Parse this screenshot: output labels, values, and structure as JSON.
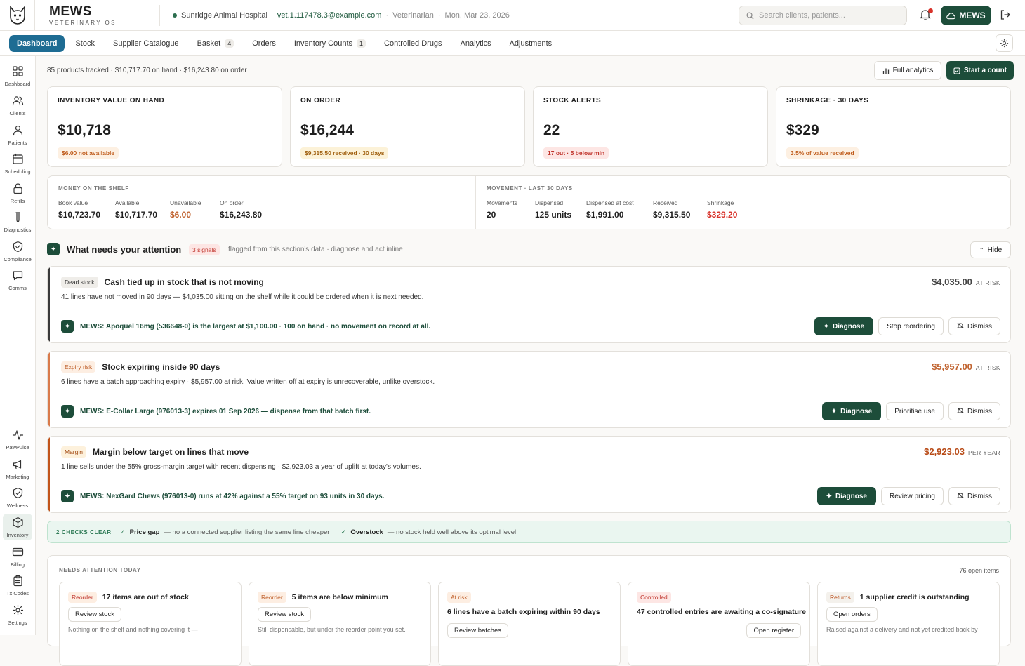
{
  "app": {
    "brand": "MEWS",
    "brand_sub": "VETERINARY OS",
    "hospital": "Sunridge Animal Hospital",
    "email": "vet.1.117478.3@example.com",
    "role": "Veterinarian",
    "date": "Mon, Mar 23, 2026",
    "search_placeholder": "Search clients, patients...",
    "mews_button": "MEWS"
  },
  "tabs": [
    {
      "label": "Dashboard",
      "count": ""
    },
    {
      "label": "Stock",
      "count": ""
    },
    {
      "label": "Supplier Catalogue",
      "count": ""
    },
    {
      "label": "Basket",
      "count": "4"
    },
    {
      "label": "Orders",
      "count": ""
    },
    {
      "label": "Inventory Counts",
      "count": "1"
    },
    {
      "label": "Controlled Drugs",
      "count": ""
    },
    {
      "label": "Analytics",
      "count": ""
    },
    {
      "label": "Adjustments",
      "count": ""
    }
  ],
  "sidebar": [
    {
      "label": "Dashboard",
      "icon": "grid-icon"
    },
    {
      "label": "Clients",
      "icon": "users-icon"
    },
    {
      "label": "Patients",
      "icon": "user-icon"
    },
    {
      "label": "Scheduling",
      "icon": "calendar-icon"
    },
    {
      "label": "Refills",
      "icon": "lock-icon"
    },
    {
      "label": "Diagnostics",
      "icon": "flask-icon"
    },
    {
      "label": "Compliance",
      "icon": "shield-check-icon"
    },
    {
      "label": "Comms",
      "icon": "chat-icon"
    },
    {
      "label": "PawPulse",
      "icon": "pulse-icon"
    },
    {
      "label": "Marketing",
      "icon": "megaphone-icon"
    },
    {
      "label": "Wellness",
      "icon": "shield-icon"
    },
    {
      "label": "Inventory",
      "icon": "box-icon"
    },
    {
      "label": "Billing",
      "icon": "card-icon"
    },
    {
      "label": "Tx Codes",
      "icon": "clipboard-icon"
    },
    {
      "label": "Settings",
      "icon": "gear-icon"
    }
  ],
  "summary": "85 products tracked · $10,717.70 on hand · $16,243.80 on order",
  "actions": {
    "full_analytics": "Full analytics",
    "start_count": "Start a count"
  },
  "kpis": [
    {
      "label": "INVENTORY VALUE ON HAND",
      "value": "$10,718",
      "pill": "$6.00 not available",
      "tone": "orange"
    },
    {
      "label": "ON ORDER",
      "value": "$16,244",
      "pill": "$9,315.50 received · 30 days",
      "tone": "yellow"
    },
    {
      "label": "STOCK ALERTS",
      "value": "22",
      "pill": "17 out · 5 below min",
      "tone": "red"
    },
    {
      "label": "SHRINKAGE · 30 DAYS",
      "value": "$329",
      "pill": "3.5% of value received",
      "tone": "orange"
    }
  ],
  "money": {
    "title": "MONEY ON THE SHELF",
    "cells": [
      {
        "label": "Book value",
        "value": "$10,723.70"
      },
      {
        "label": "Available",
        "value": "$10,717.70"
      },
      {
        "label": "Unavailable",
        "value": "$6.00"
      },
      {
        "label": "On order",
        "value": "$16,243.80"
      }
    ]
  },
  "movement": {
    "title": "MOVEMENT · LAST 30 DAYS",
    "cells": [
      {
        "label": "Movements",
        "value": "20"
      },
      {
        "label": "Dispensed",
        "value": "125 units"
      },
      {
        "label": "Dispensed at cost",
        "value": "$1,991.00"
      },
      {
        "label": "Received",
        "value": "$9,315.50"
      },
      {
        "label": "Shrinkage",
        "value": "$329.20"
      }
    ]
  },
  "attention": {
    "title": "What needs your attention",
    "signals_badge": "3 signals",
    "subtitle": "flagged from this section's data · diagnose and act inline",
    "hide": "Hide"
  },
  "signals": [
    {
      "tag": "Dead stock",
      "title": "Cash tied up in stock that is not moving",
      "desc": "41 lines have not moved in 90 days — $4,035.00 sitting on the shelf while it could be ordered when it is next needed.",
      "amount": "$4,035.00",
      "unit": "AT RISK",
      "ai": "MEWS: Apoquel 16mg (536648-0) is the largest at $1,100.00 · 100 on hand · no movement on record at all.",
      "diagnose": "Diagnose",
      "secondary": "Stop reordering",
      "dismiss": "Dismiss",
      "color": "#3a3a3a",
      "amount_color": "#444444"
    },
    {
      "tag": "Expiry risk",
      "title": "Stock expiring inside 90 days",
      "desc": "6 lines have a batch approaching expiry · $5,957.00 at risk. Value written off at expiry is unrecoverable, unlike overstock.",
      "amount": "$5,957.00",
      "unit": "AT RISK",
      "ai": "MEWS: E-Collar Large (976013-3) expires 01 Sep 2026 — dispense from that batch first.",
      "diagnose": "Diagnose",
      "secondary": "Prioritise use",
      "dismiss": "Dismiss",
      "color": "#d97a4a",
      "amount_color": "#c0622e"
    },
    {
      "tag": "Margin",
      "title": "Margin below target on lines that move",
      "desc": "1 line sells under the 55% gross-margin target with recent dispensing · $2,923.03 a year of uplift at today's volumes.",
      "amount": "$2,923.03",
      "unit": "PER YEAR",
      "ai": "MEWS: NexGard Chews (976013-0) runs at 42% against a 55% target on 93 units in 30 days.",
      "diagnose": "Diagnose",
      "secondary": "Review pricing",
      "dismiss": "Dismiss",
      "color": "#c2541a",
      "amount_color": "#b84a16"
    }
  ],
  "checks": {
    "label": "2 CHECKS CLEAR",
    "items": [
      {
        "name": "Price gap",
        "desc": "— no a connected supplier listing the same line cheaper"
      },
      {
        "name": "Overstock",
        "desc": "— no stock held well above its optimal level"
      }
    ]
  },
  "needs_today": {
    "title": "NEEDS ATTENTION TODAY",
    "count": "76 open items",
    "cards": [
      {
        "tag": "Reorder",
        "title": "17 items are out of stock",
        "button": "Review stock",
        "sub": "Nothing on the shelf and nothing covering it —"
      },
      {
        "tag": "Reorder",
        "title": "5 items are below minimum",
        "button": "Review stock",
        "sub": "Still dispensable, but under the reorder point you set."
      },
      {
        "tag": "At risk",
        "title": "6 lines have a batch expiring within 90 days",
        "button": "Review batches",
        "sub": ""
      },
      {
        "tag": "Controlled",
        "title": "47 controlled entries are awaiting a co-signature",
        "button": "Open register",
        "sub": ""
      },
      {
        "tag": "Returns",
        "title": "1 supplier credit is outstanding",
        "button": "Open orders",
        "sub": "Raised against a delivery and not yet credited back by"
      }
    ]
  }
}
